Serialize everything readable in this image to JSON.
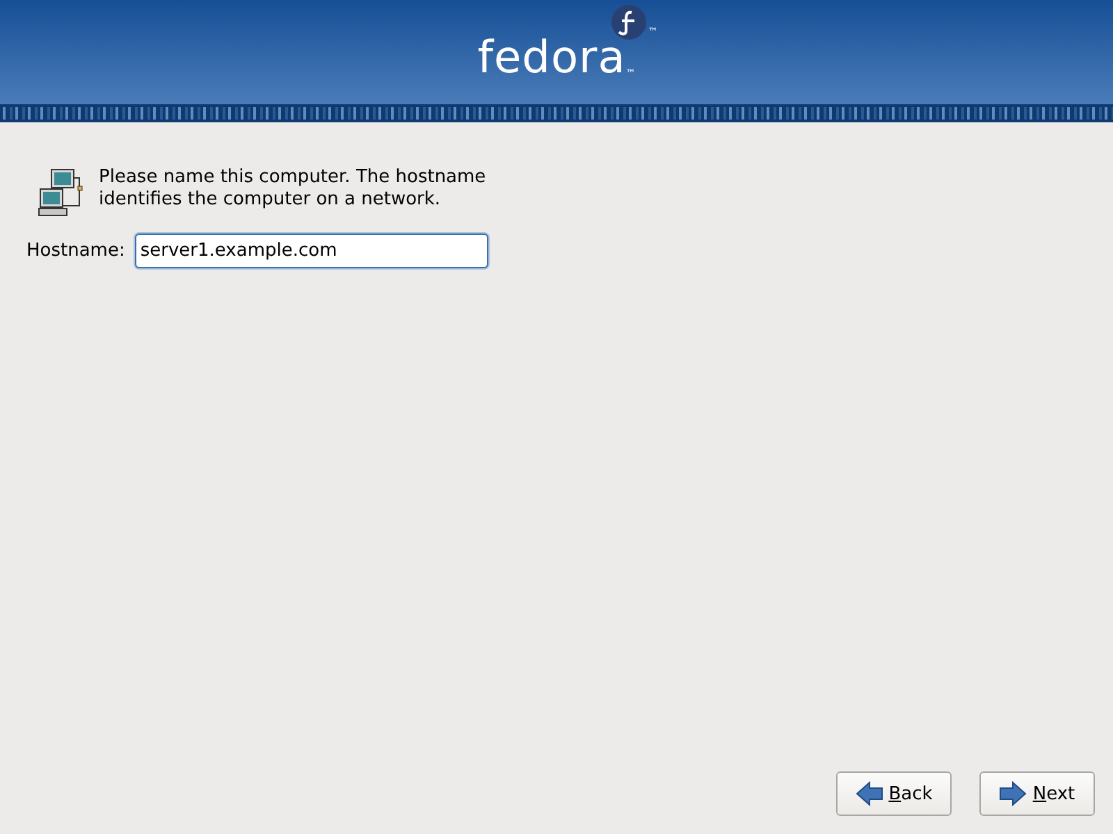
{
  "header": {
    "logo_text": "fedora",
    "logo_mark": "™",
    "logo_text_mark": "™"
  },
  "intro": "Please name this computer.  The hostname identifies the computer on a network.",
  "hostname": {
    "label": "Hostname:",
    "value": "server1.example.com"
  },
  "buttons": [
    {
      "label": "Back",
      "kind": "back"
    },
    {
      "label": "Next",
      "kind": "next"
    }
  ]
}
